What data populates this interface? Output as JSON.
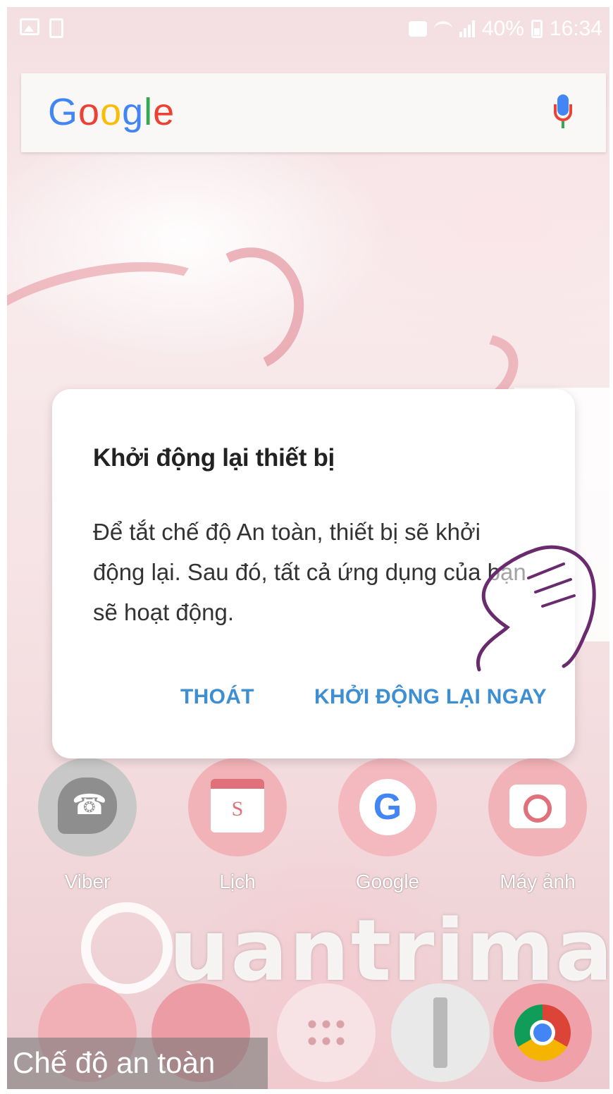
{
  "status_bar": {
    "battery": "40%",
    "time": "16:34"
  },
  "search": {
    "logo": [
      "G",
      "o",
      "o",
      "g",
      "l",
      "e"
    ]
  },
  "dialog": {
    "title": "Khởi động lại thiết bị",
    "message": "Để tắt chế độ An toàn, thiết bị sẽ khởi động lại. Sau đó, tất cả ứng dụng của bạn sẽ hoạt động.",
    "exit_button": "THOÁT",
    "restart_button": "KHỞI ĐỘNG LẠI NGAY"
  },
  "apps": {
    "viber": "Viber",
    "lich": "Lịch",
    "google": "Google",
    "camera": "Máy ảnh",
    "lich_glyph": "S",
    "google_glyph": "G",
    "viber_glyph": "☎"
  },
  "watermark": "uantrimang",
  "safe_mode_label": "Chế độ an toàn",
  "colors": {
    "dialog_button": "#3d8fd1",
    "wallpaper": "#f4dfe2"
  }
}
